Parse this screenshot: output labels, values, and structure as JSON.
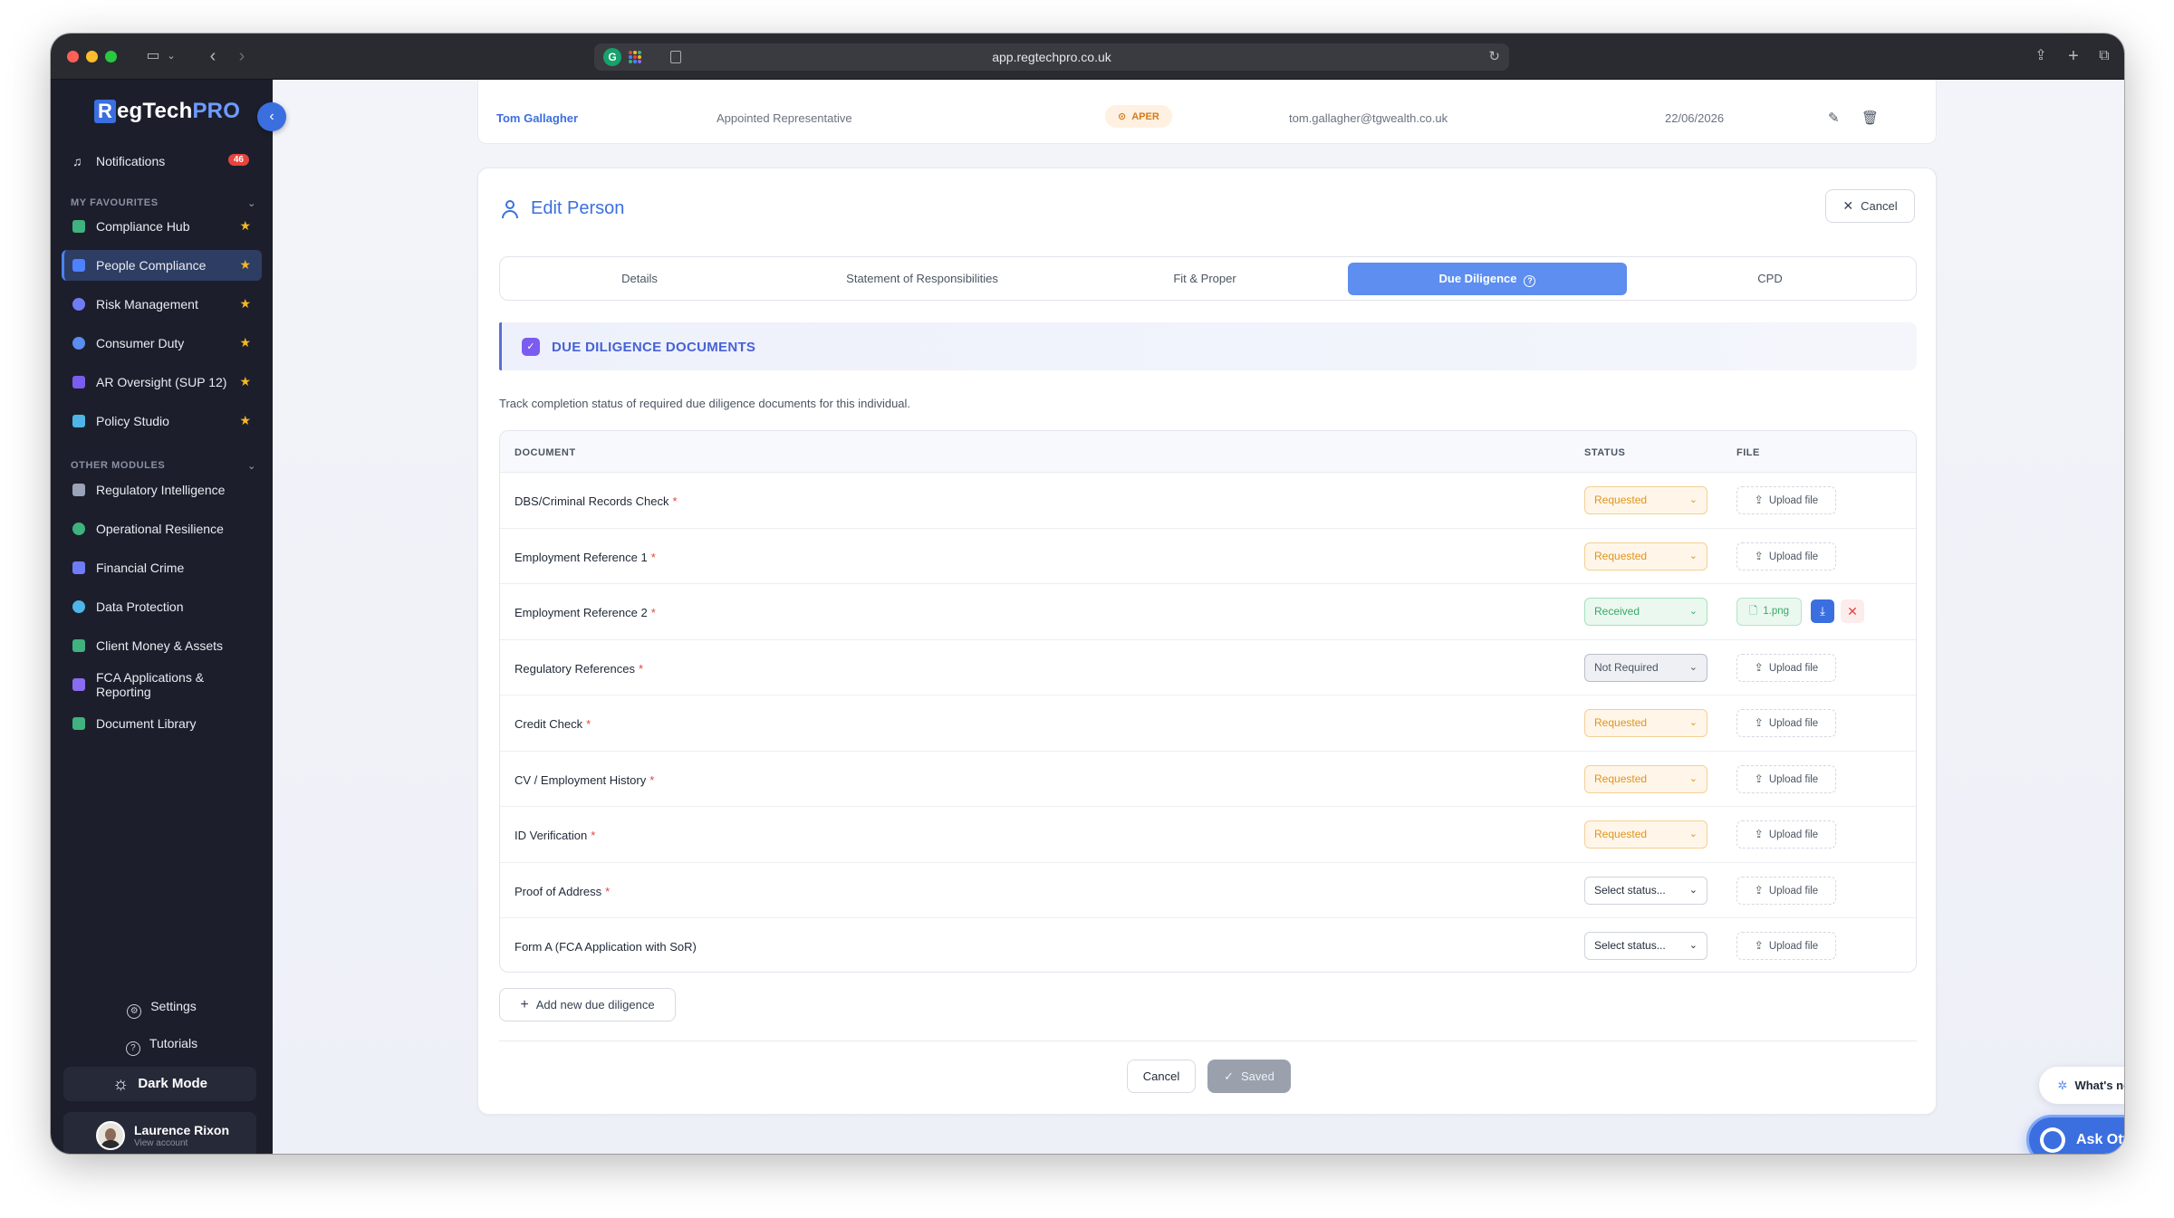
{
  "browser": {
    "url": "app.regtechpro.co.uk"
  },
  "brand": {
    "logo_letter": "R",
    "logo_mid": "egTech",
    "logo_end": "PRO",
    "accent": "#3b6fe0"
  },
  "sidebar": {
    "notifications_label": "Notifications",
    "notifications_count": "46",
    "favourites_header": "MY FAVOURITES",
    "favourites": [
      {
        "label": "Compliance Hub",
        "icon": "compliance-hub-icon",
        "color": "#3fb27f"
      },
      {
        "label": "People Compliance",
        "icon": "people-icon",
        "color": "#4c82ff"
      },
      {
        "label": "Risk Management",
        "icon": "shield-icon",
        "color": "#6f7cf5"
      },
      {
        "label": "Consumer Duty",
        "icon": "consumer-duty-icon",
        "color": "#5b8cf0"
      },
      {
        "label": "AR Oversight (SUP 12)",
        "icon": "network-icon",
        "color": "#7a5cf0"
      },
      {
        "label": "Policy Studio",
        "icon": "policy-icon",
        "color": "#4fb5e8"
      }
    ],
    "other_header": "OTHER MODULES",
    "others": [
      {
        "label": "Regulatory Intelligence",
        "icon": "regulatory-icon",
        "color": "#9aa3b8"
      },
      {
        "label": "Operational Resilience",
        "icon": "resilience-icon",
        "color": "#3fb27f"
      },
      {
        "label": "Financial Crime",
        "icon": "financial-crime-icon",
        "color": "#6f7cf5"
      },
      {
        "label": "Data Protection",
        "icon": "data-protection-icon",
        "color": "#4fb5e8"
      },
      {
        "label": "Client Money & Assets",
        "icon": "bank-icon",
        "color": "#3fb27f"
      },
      {
        "label": "FCA Applications & Reporting",
        "icon": "fca-icon",
        "color": "#8a6cf0"
      },
      {
        "label": "Document Library",
        "icon": "library-icon",
        "color": "#3fb27f"
      }
    ],
    "settings_label": "Settings",
    "tutorials_label": "Tutorials",
    "dark_mode_label": "Dark Mode",
    "user_name": "Laurence Rixon",
    "user_sub": "View account"
  },
  "person_row": {
    "name": "Tom Gallagher",
    "role": "Appointed Representative",
    "badge": "APER",
    "email": "tom.gallagher@tgwealth.co.uk",
    "date": "22/06/2026"
  },
  "panel": {
    "title": "Edit Person",
    "cancel_label": "Cancel",
    "tabs": [
      {
        "label": "Details"
      },
      {
        "label": "Statement of Responsibilities"
      },
      {
        "label": "Fit & Proper"
      },
      {
        "label": "Due Diligence"
      },
      {
        "label": "CPD"
      }
    ],
    "active_tab": "Due Diligence",
    "section_title": "DUE DILIGENCE DOCUMENTS",
    "description": "Track completion status of required due diligence documents for this individual.",
    "columns": {
      "document": "DOCUMENT",
      "status": "STATUS",
      "file": "FILE"
    },
    "rows": [
      {
        "document": "DBS/Criminal Records Check",
        "required": true,
        "status": "Requested",
        "file": null
      },
      {
        "document": "Employment Reference 1",
        "required": true,
        "status": "Requested",
        "file": null
      },
      {
        "document": "Employment Reference 2",
        "required": true,
        "status": "Received",
        "file": "1.png"
      },
      {
        "document": "Regulatory References",
        "required": true,
        "status": "Not Required",
        "file": null
      },
      {
        "document": "Credit Check",
        "required": true,
        "status": "Requested",
        "file": null
      },
      {
        "document": "CV / Employment History",
        "required": true,
        "status": "Requested",
        "file": null
      },
      {
        "document": "ID Verification",
        "required": true,
        "status": "Requested",
        "file": null
      },
      {
        "document": "Proof of Address",
        "required": true,
        "status": "Select status...",
        "file": null
      },
      {
        "document": "Form A (FCA Application with SoR)",
        "required": false,
        "status": "Select status...",
        "file": null
      }
    ],
    "upload_label": "Upload file",
    "add_label": "Add new due diligence",
    "footer_cancel": "Cancel",
    "footer_saved": "Saved"
  },
  "floating": {
    "whats_new": "What's new",
    "ask_otto": "Ask Otto"
  }
}
